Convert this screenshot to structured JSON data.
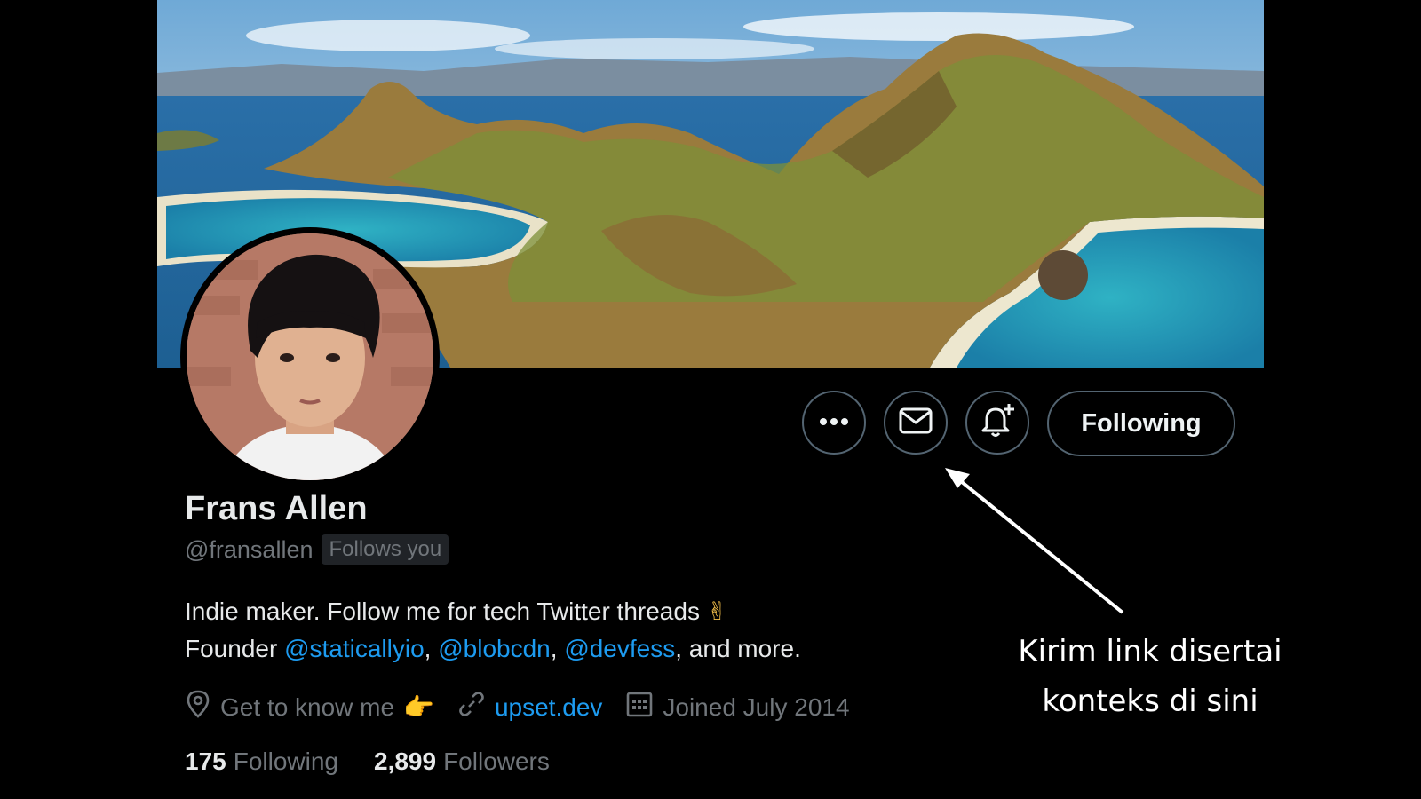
{
  "profile": {
    "display_name": "Frans Allen",
    "handle": "@fransallen",
    "follows_you": "Follows you",
    "bio": {
      "line1": "Indie maker. Follow me for tech Twitter threads",
      "line1_emoji": "✌",
      "line2_prefix": "Founder ",
      "mention1": "@staticallyio",
      "sep1": ", ",
      "mention2": "@blobcdn",
      "sep2": ", ",
      "mention3": "@devfess",
      "line2_suffix": ", and more."
    },
    "location": "Get to know me",
    "location_emoji": "👉",
    "website": "upset.dev",
    "joined": "Joined July 2014",
    "following_count": "175",
    "following_label": "Following",
    "followers_count": "2,899",
    "followers_label": "Followers"
  },
  "actions": {
    "more_icon": "more-icon",
    "message_icon": "envelope-icon",
    "notify_icon": "bell-plus-icon",
    "following_button": "Following"
  },
  "annotation": {
    "line1": "Kirim link disertai",
    "line2": "konteks di sini"
  },
  "colors": {
    "background": "#000000",
    "accent": "#1d9bf0",
    "secondary_text": "#71767b",
    "border": "#536471"
  }
}
